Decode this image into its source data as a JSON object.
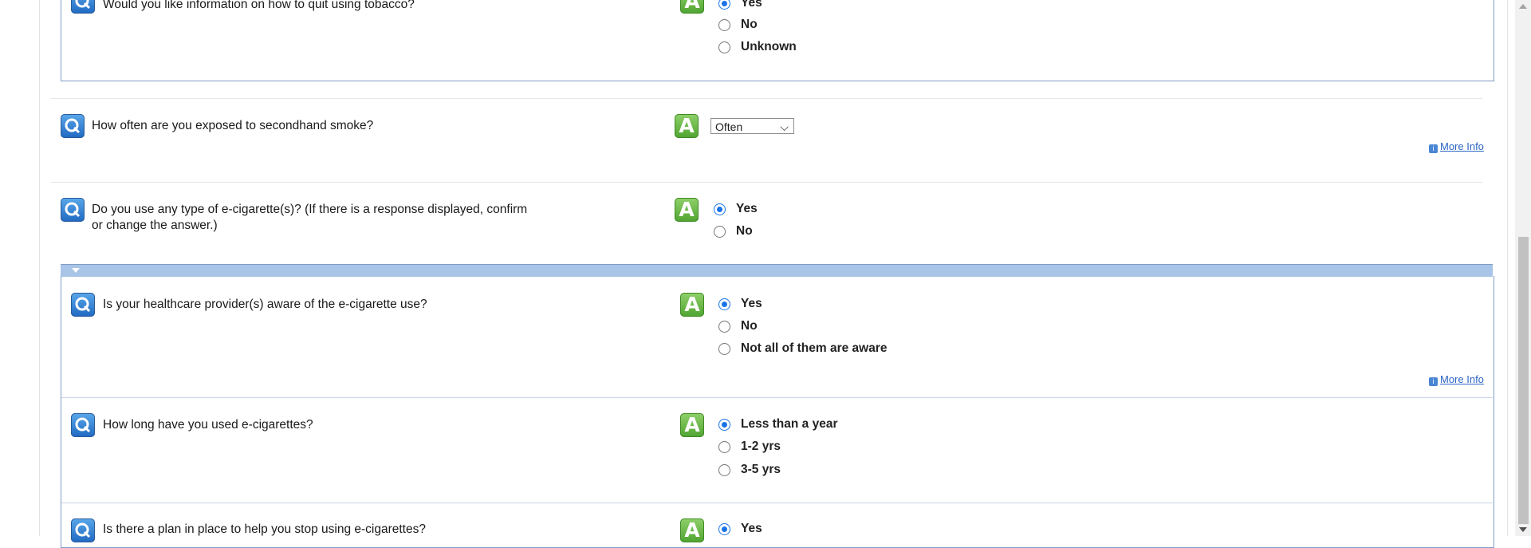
{
  "icons": {
    "question": "Q",
    "answer": "A",
    "info": "i"
  },
  "colors": {
    "accent": "#1a73e8",
    "link": "#2b64c2",
    "panel_border": "#7f9dc4",
    "section_bar": "#a8c4e6"
  },
  "questions": {
    "q_quit_info": {
      "text": "Would you like information on how to quit using tobacco?",
      "options": [
        "Yes",
        "No",
        "Unknown"
      ],
      "selected": "Yes"
    },
    "q_secondhand": {
      "text": "How often are you exposed to secondhand smoke?",
      "select_value": "Often",
      "more_info": "More Info"
    },
    "q_ecig_use": {
      "text_line1": "Do you use any type of e-cigarette(s)? (If there is a response displayed, confirm",
      "text_line2": "or change the answer.)",
      "options": [
        "Yes",
        "No"
      ],
      "selected": "Yes"
    },
    "q_provider_aware": {
      "text": "Is your healthcare provider(s) aware of the e-cigarette use?",
      "options": [
        "Yes",
        "No",
        "Not all of them are aware"
      ],
      "selected": "Yes",
      "more_info": "More Info"
    },
    "q_ecig_duration": {
      "text": "How long have you used e-cigarettes?",
      "options": [
        "Less than a year",
        "1-2 yrs",
        "3-5 yrs"
      ],
      "selected": "Less than a year"
    },
    "q_stop_plan": {
      "text": "Is there a plan in place to help you stop using e-cigarettes?",
      "options": [
        "Yes"
      ],
      "selected": "Yes"
    }
  }
}
